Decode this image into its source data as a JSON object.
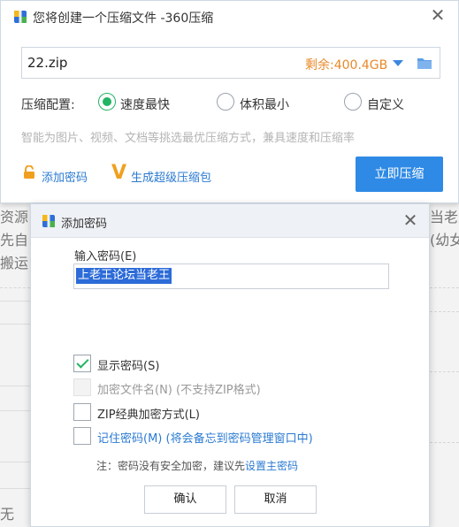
{
  "background": {
    "fragments": [
      "资源",
      "先自己",
      "搬运",
      "当老王",
      "(幼女",
      "无"
    ]
  },
  "main_window": {
    "title": "您将创建一个压缩文件 -360压缩",
    "close_symbol": "✕",
    "path_value": "22.zip",
    "remaining_space": "剩余:400.4GB",
    "config_label": "压缩配置:",
    "options": [
      {
        "label": "速度最快",
        "selected": true
      },
      {
        "label": "体积最小",
        "selected": false
      },
      {
        "label": "自定义",
        "selected": false
      }
    ],
    "hint": "智能为图片、视频、文档等挑选最优压缩方式，兼具速度和压缩率",
    "add_password_link": "添加密码",
    "super_package_link": "生成超级压缩包",
    "compress_button": "立即压缩",
    "colors": {
      "accent": "#2f8ae5",
      "remaining": "#e8892a",
      "selected": "#23b364"
    }
  },
  "password_dialog": {
    "title": "添加密码",
    "close_symbol": "✕",
    "input_label": "输入密码(E)",
    "input_value": "上老王论坛当老王",
    "checkboxes": [
      {
        "label": "显示密码(S)",
        "checked": true,
        "disabled": false
      },
      {
        "label": "加密文件名(N) (不支持ZIP格式)",
        "checked": false,
        "disabled": true
      },
      {
        "label": "ZIP经典加密方式(L)",
        "checked": false,
        "disabled": false
      },
      {
        "label": "记住密码(M) (将会备忘到密码管理窗口中)",
        "checked": false,
        "disabled": false
      }
    ],
    "note_prefix": "注：密码没有安全加密，建议先",
    "note_link": "设置主密码",
    "ok_button": "确认",
    "cancel_button": "取消"
  }
}
